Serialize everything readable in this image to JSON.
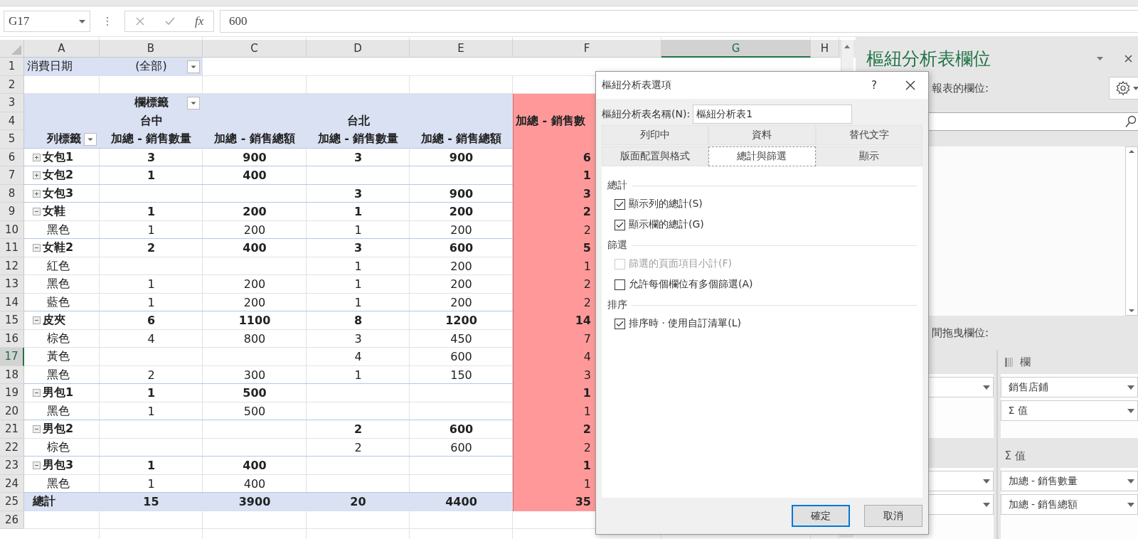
{
  "formula_bar": {
    "name_box": "G17",
    "fx": "fx",
    "formula": "600"
  },
  "sheet": {
    "columns": [
      {
        "label": "A",
        "selected": false
      },
      {
        "label": "B",
        "selected": false
      },
      {
        "label": "C",
        "selected": false
      },
      {
        "label": "D",
        "selected": false
      },
      {
        "label": "E",
        "selected": false
      },
      {
        "label": "F",
        "selected": false
      },
      {
        "label": "G",
        "selected": true
      },
      {
        "label": "H",
        "selected": false
      }
    ],
    "rows": [
      {
        "number": "1",
        "selected": false,
        "kind": "filter",
        "a": "消費日期",
        "b": "(全部)"
      },
      {
        "number": "2",
        "selected": false,
        "kind": "blank"
      },
      {
        "number": "3",
        "selected": false,
        "kind": "column_labels",
        "b": "欄標籤"
      },
      {
        "number": "4",
        "selected": false,
        "kind": "stores",
        "b": "台中",
        "d": "台北",
        "f": "加總 - 銷售數"
      },
      {
        "number": "5",
        "selected": false,
        "kind": "value_headers",
        "a": "列標籤",
        "b": "加總 - 銷售數量",
        "c": "加總 - 銷售總額",
        "d": "加總 - 銷售數量",
        "e": "加總 - 銷售總額"
      },
      {
        "number": "6",
        "selected": false,
        "kind": "group",
        "expanded": false,
        "a": "女包1",
        "b": "3",
        "c": "900",
        "d": "3",
        "e": "900",
        "f": "6"
      },
      {
        "number": "7",
        "selected": false,
        "kind": "group",
        "expanded": false,
        "a": "女包2",
        "b": "1",
        "c": "400",
        "f": "1"
      },
      {
        "number": "8",
        "selected": false,
        "kind": "group",
        "expanded": false,
        "a": "女包3",
        "d": "3",
        "e": "900",
        "f": "3"
      },
      {
        "number": "9",
        "selected": false,
        "kind": "group",
        "expanded": true,
        "a": "女鞋",
        "b": "1",
        "c": "200",
        "d": "1",
        "e": "200",
        "f": "2"
      },
      {
        "number": "10",
        "selected": false,
        "kind": "item",
        "a": "黑色",
        "b": "1",
        "c": "200",
        "d": "1",
        "e": "200",
        "f": "2"
      },
      {
        "number": "11",
        "selected": false,
        "kind": "group",
        "expanded": true,
        "a": "女鞋2",
        "b": "2",
        "c": "400",
        "d": "3",
        "e": "600",
        "f": "5"
      },
      {
        "number": "12",
        "selected": false,
        "kind": "item",
        "a": "紅色",
        "d": "1",
        "e": "200",
        "f": "1"
      },
      {
        "number": "13",
        "selected": false,
        "kind": "item",
        "a": "黑色",
        "b": "1",
        "c": "200",
        "d": "1",
        "e": "200",
        "f": "2"
      },
      {
        "number": "14",
        "selected": false,
        "kind": "item",
        "a": "藍色",
        "b": "1",
        "c": "200",
        "d": "1",
        "e": "200",
        "f": "2"
      },
      {
        "number": "15",
        "selected": false,
        "kind": "group",
        "expanded": true,
        "a": "皮夾",
        "b": "6",
        "c": "1100",
        "d": "8",
        "e": "1200",
        "f": "14"
      },
      {
        "number": "16",
        "selected": false,
        "kind": "item",
        "a": "棕色",
        "b": "4",
        "c": "800",
        "d": "3",
        "e": "450",
        "f": "7"
      },
      {
        "number": "17",
        "selected": true,
        "kind": "item",
        "a": "黃色",
        "d": "4",
        "e": "600",
        "f": "4"
      },
      {
        "number": "18",
        "selected": false,
        "kind": "item",
        "a": "黑色",
        "b": "2",
        "c": "300",
        "d": "1",
        "e": "150",
        "f": "3"
      },
      {
        "number": "19",
        "selected": false,
        "kind": "group",
        "expanded": true,
        "a": "男包1",
        "b": "1",
        "c": "500",
        "f": "1"
      },
      {
        "number": "20",
        "selected": false,
        "kind": "item",
        "a": "黑色",
        "b": "1",
        "c": "500",
        "f": "1"
      },
      {
        "number": "21",
        "selected": false,
        "kind": "group",
        "expanded": true,
        "a": "男包2",
        "d": "2",
        "e": "600",
        "f": "2"
      },
      {
        "number": "22",
        "selected": false,
        "kind": "item",
        "a": "棕色",
        "d": "2",
        "e": "600",
        "f": "2"
      },
      {
        "number": "23",
        "selected": false,
        "kind": "group",
        "expanded": true,
        "a": "男包3",
        "b": "1",
        "c": "400",
        "f": "1"
      },
      {
        "number": "24",
        "selected": false,
        "kind": "item",
        "a": "黑色",
        "b": "1",
        "c": "400",
        "f": "1"
      },
      {
        "number": "25",
        "selected": false,
        "kind": "total",
        "a": "總計",
        "b": "15",
        "c": "3900",
        "d": "20",
        "e": "4400",
        "f": "35"
      },
      {
        "number": "26",
        "selected": false,
        "kind": "blank"
      }
    ]
  },
  "pane": {
    "title": "樞紐分析表欄位",
    "choose_label": "報表的欄位:",
    "drag_label": "間拖曳欄位:",
    "columns_area": {
      "header": "欄",
      "items": [
        "銷售店鋪",
        "Σ 值"
      ]
    },
    "values_area": {
      "header": "Σ 值",
      "items": [
        "加總 - 銷售數量",
        "加總 - 銷售總額"
      ]
    }
  },
  "dialog": {
    "title": "樞紐分析表選項",
    "help": "?",
    "name_label": "樞紐分析表名稱(N):",
    "name_value": "樞紐分析表1",
    "tab_rows": [
      {
        "tabs": [
          {
            "label": "列印中",
            "selected": false
          },
          {
            "label": "資料",
            "selected": false
          },
          {
            "label": "替代文字",
            "selected": false
          }
        ]
      },
      {
        "tabs": [
          {
            "label": "版面配置與格式",
            "selected": false
          },
          {
            "label": "總計與篩選",
            "selected": true
          },
          {
            "label": "顯示",
            "selected": false
          }
        ]
      }
    ],
    "sections": [
      {
        "title": "總計",
        "options": [
          {
            "label": "顯示列的總計(S)",
            "checked": true,
            "disabled": false
          },
          {
            "label": "顯示欄的總計(G)",
            "checked": true,
            "disabled": false
          }
        ]
      },
      {
        "title": "篩選",
        "options": [
          {
            "label": "篩選的頁面項目小計(F)",
            "checked": false,
            "disabled": true
          },
          {
            "label": "允許每個欄位有多個篩選(A)",
            "checked": false,
            "disabled": false
          }
        ]
      },
      {
        "title": "排序",
        "options": [
          {
            "label": "排序時 · 使用自訂清單(L)",
            "checked": true,
            "disabled": false
          }
        ]
      }
    ],
    "buttons": [
      {
        "label": "確定",
        "default": true
      },
      {
        "label": "取消",
        "default": false
      }
    ]
  }
}
